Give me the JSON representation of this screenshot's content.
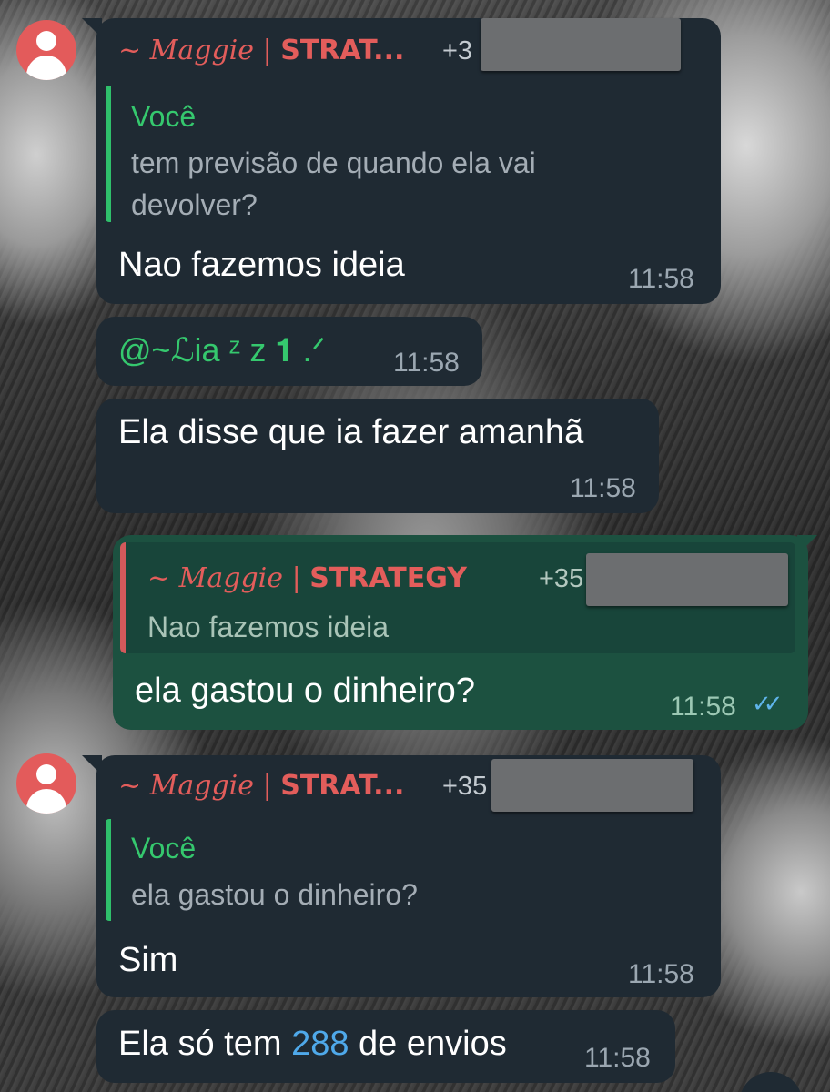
{
  "chat": {
    "messages": [
      {
        "sender_name": "~ Maggie | ",
        "sender_strat": "STRAT...",
        "sender_phone": "+3",
        "reply_author": "Você",
        "reply_text": "tem previsão de quando ela vai devolver?",
        "text": "Nao fazemos ideia",
        "time": "11:58"
      },
      {
        "mention": "@~ℒia ᶻ z 𝟏 .ᐟ",
        "time": "11:58"
      },
      {
        "text": "Ela disse que ia fazer amanhã",
        "time": "11:58"
      },
      {
        "reply_sender_name": "~ Maggie | ",
        "reply_sender_strat": "STRATEGY",
        "reply_sender_phone": "+35",
        "reply_text": "Nao fazemos ideia",
        "text": "ela gastou o dinheiro?",
        "time": "11:58",
        "status_icon": "double-check-icon"
      },
      {
        "sender_name": "~ Maggie | ",
        "sender_strat": "STRAT...",
        "sender_phone": "+35",
        "reply_author": "Você",
        "reply_text": "ela gastou o dinheiro?",
        "text": "Sim",
        "time": "11:58"
      },
      {
        "text_before": "Ela só tem ",
        "number": "288",
        "text_after": " de envios",
        "time": "11:58"
      }
    ]
  },
  "colors": {
    "incoming_bubble": "#1f2a33",
    "outgoing_bubble": "#1c5140",
    "sender_name": "#e35d5b",
    "quote_author": "#35c86e",
    "link_number": "#4fa9ea",
    "avatar": "#e35b5b"
  }
}
